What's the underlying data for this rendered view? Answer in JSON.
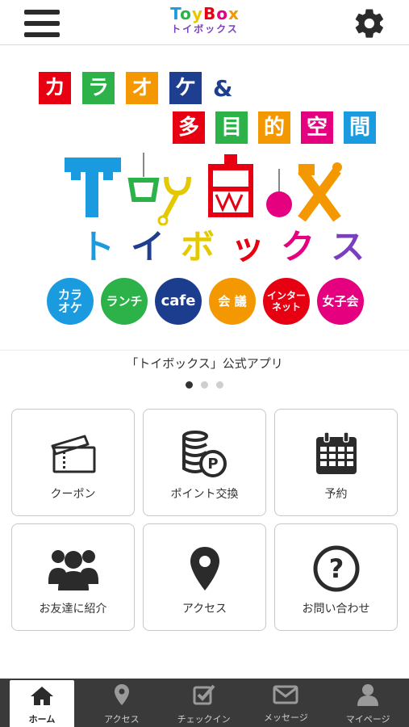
{
  "header": {
    "logo_line1": "ToyBox",
    "logo_line2": "トイボックス"
  },
  "banner": {
    "row1": [
      "カ",
      "ラ",
      "オ",
      "ケ"
    ],
    "row1_amp": "&",
    "row2": [
      "多",
      "目",
      "的",
      "空",
      "間"
    ],
    "logo_text": "ToyBox",
    "kana": [
      "ト",
      "イ",
      "ボ",
      "ッ",
      "ク",
      "ス"
    ],
    "circles": [
      {
        "text": "カラ\nオケ",
        "color": "#1a9be0"
      },
      {
        "text": "ランチ",
        "color": "#2db24a"
      },
      {
        "text": "cafe",
        "color": "#1c3c8e"
      },
      {
        "text": "会 議",
        "color": "#f39800"
      },
      {
        "text": "インター\nネット",
        "color": "#e60012"
      },
      {
        "text": "女子会",
        "color": "#e4007f"
      }
    ]
  },
  "caption": "「トイボックス」公式アプリ",
  "carousel": {
    "pages": 3,
    "current": 1
  },
  "menu": [
    {
      "label": "クーポン",
      "icon": "ticket-icon"
    },
    {
      "label": "ポイント交換",
      "icon": "coins-icon"
    },
    {
      "label": "予約",
      "icon": "calendar-icon"
    },
    {
      "label": "お友達に紹介",
      "icon": "users-icon"
    },
    {
      "label": "アクセス",
      "icon": "map-pin-icon"
    },
    {
      "label": "お問い合わせ",
      "icon": "question-icon"
    }
  ],
  "bottom_nav": [
    {
      "label": "ホーム",
      "icon": "home-icon",
      "active": true
    },
    {
      "label": "アクセス",
      "icon": "map-pin-icon",
      "active": false
    },
    {
      "label": "チェックイン",
      "icon": "checkbox-icon",
      "active": false
    },
    {
      "label": "メッセージ",
      "icon": "mail-icon",
      "active": false
    },
    {
      "label": "マイページ",
      "icon": "person-icon",
      "active": false
    }
  ],
  "colors": {
    "red": "#e60012",
    "green": "#2db24a",
    "orange": "#f39800",
    "navy": "#1e3f8f",
    "magenta": "#e4007f",
    "blue": "#1a9be0",
    "nav_bg": "#3a3a3a"
  }
}
